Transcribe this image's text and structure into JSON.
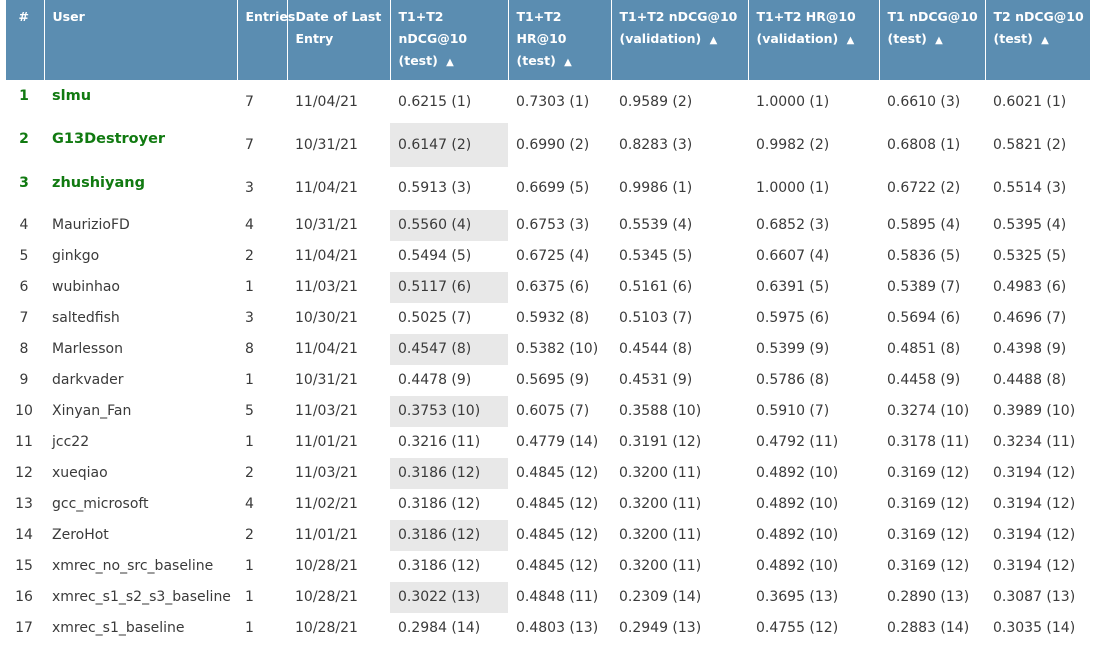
{
  "headers": [
    {
      "label": "#",
      "sort": ""
    },
    {
      "label": "User",
      "sort": ""
    },
    {
      "label": "Entries",
      "sort": ""
    },
    {
      "label": "Date of Last Entry",
      "sort": ""
    },
    {
      "label": "T1+T2 nDCG@10 (test)",
      "sort": "▲"
    },
    {
      "label": "T1+T2 HR@10 (test)",
      "sort": "▲"
    },
    {
      "label": "T1+T2 nDCG@10 (validation)",
      "sort": "▲"
    },
    {
      "label": "T1+T2 HR@10 (validation)",
      "sort": "▲"
    },
    {
      "label": "T1 nDCG@10 (test)",
      "sort": "▲"
    },
    {
      "label": "T2 nDCG@10 (test)",
      "sort": "▲"
    }
  ],
  "rows": [
    [
      "1",
      "slmu",
      "7",
      "11/04/21",
      "0.6215 (1)",
      "0.7303 (1)",
      "0.9589 (2)",
      "1.0000 (1)",
      "0.6610 (3)",
      "0.6021 (1)"
    ],
    [
      "2",
      "G13Destroyer",
      "7",
      "10/31/21",
      "0.6147 (2)",
      "0.6990 (2)",
      "0.8283 (3)",
      "0.9982 (2)",
      "0.6808 (1)",
      "0.5821 (2)"
    ],
    [
      "3",
      "zhushiyang",
      "3",
      "11/04/21",
      "0.5913 (3)",
      "0.6699 (5)",
      "0.9986 (1)",
      "1.0000 (1)",
      "0.6722 (2)",
      "0.5514 (3)"
    ],
    [
      "4",
      "MaurizioFD",
      "4",
      "10/31/21",
      "0.5560 (4)",
      "0.6753 (3)",
      "0.5539 (4)",
      "0.6852 (3)",
      "0.5895 (4)",
      "0.5395 (4)"
    ],
    [
      "5",
      "ginkgo",
      "2",
      "11/04/21",
      "0.5494 (5)",
      "0.6725 (4)",
      "0.5345 (5)",
      "0.6607 (4)",
      "0.5836 (5)",
      "0.5325 (5)"
    ],
    [
      "6",
      "wubinhao",
      "1",
      "11/03/21",
      "0.5117 (6)",
      "0.6375 (6)",
      "0.5161 (6)",
      "0.6391 (5)",
      "0.5389 (7)",
      "0.4983 (6)"
    ],
    [
      "7",
      "saltedfish",
      "3",
      "10/30/21",
      "0.5025 (7)",
      "0.5932 (8)",
      "0.5103 (7)",
      "0.5975 (6)",
      "0.5694 (6)",
      "0.4696 (7)"
    ],
    [
      "8",
      "Marlesson",
      "8",
      "11/04/21",
      "0.4547 (8)",
      "0.5382 (10)",
      "0.4544 (8)",
      "0.5399 (9)",
      "0.4851 (8)",
      "0.4398 (9)"
    ],
    [
      "9",
      "darkvader",
      "1",
      "10/31/21",
      "0.4478 (9)",
      "0.5695 (9)",
      "0.4531 (9)",
      "0.5786 (8)",
      "0.4458 (9)",
      "0.4488 (8)"
    ],
    [
      "10",
      "Xinyan_Fan",
      "5",
      "11/03/21",
      "0.3753 (10)",
      "0.6075 (7)",
      "0.3588 (10)",
      "0.5910 (7)",
      "0.3274 (10)",
      "0.3989 (10)"
    ],
    [
      "11",
      "jcc22",
      "1",
      "11/01/21",
      "0.3216 (11)",
      "0.4779 (14)",
      "0.3191 (12)",
      "0.4792 (11)",
      "0.3178 (11)",
      "0.3234 (11)"
    ],
    [
      "12",
      "xueqiao",
      "2",
      "11/03/21",
      "0.3186 (12)",
      "0.4845 (12)",
      "0.3200 (11)",
      "0.4892 (10)",
      "0.3169 (12)",
      "0.3194 (12)"
    ],
    [
      "13",
      "gcc_microsoft",
      "4",
      "11/02/21",
      "0.3186 (12)",
      "0.4845 (12)",
      "0.3200 (11)",
      "0.4892 (10)",
      "0.3169 (12)",
      "0.3194 (12)"
    ],
    [
      "14",
      "ZeroHot",
      "2",
      "11/01/21",
      "0.3186 (12)",
      "0.4845 (12)",
      "0.3200 (11)",
      "0.4892 (10)",
      "0.3169 (12)",
      "0.3194 (12)"
    ],
    [
      "15",
      "xmrec_no_src_baseline",
      "1",
      "10/28/21",
      "0.3186 (12)",
      "0.4845 (12)",
      "0.3200 (11)",
      "0.4892 (10)",
      "0.3169 (12)",
      "0.3194 (12)"
    ],
    [
      "16",
      "xmrec_s1_s2_s3_baseline",
      "1",
      "10/28/21",
      "0.3022 (13)",
      "0.4848 (11)",
      "0.2309 (14)",
      "0.3695 (13)",
      "0.2890 (13)",
      "0.3087 (13)"
    ],
    [
      "17",
      "xmrec_s1_baseline",
      "1",
      "10/28/21",
      "0.2984 (14)",
      "0.4803 (13)",
      "0.2949 (13)",
      "0.4755 (12)",
      "0.2883 (14)",
      "0.3035 (14)"
    ]
  ]
}
